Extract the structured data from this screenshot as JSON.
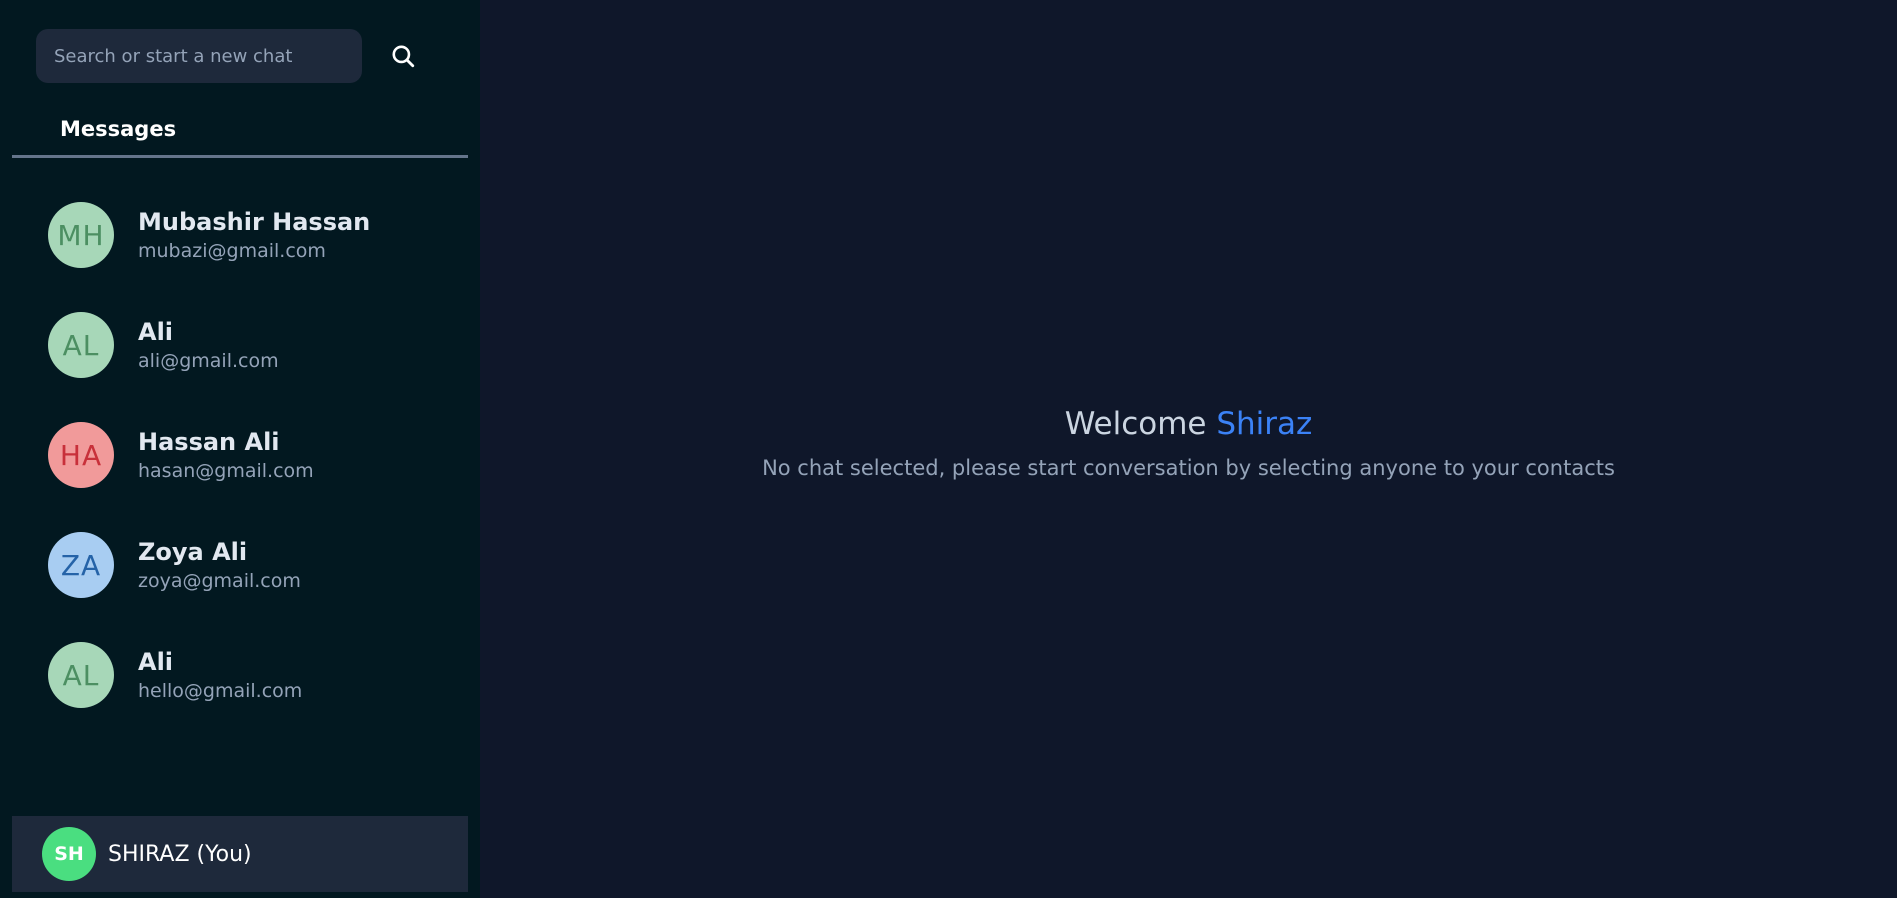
{
  "search": {
    "placeholder": "Search or start a new chat",
    "icon": "search-icon"
  },
  "tabs": {
    "messages_label": "Messages"
  },
  "contacts": [
    {
      "initials": "MH",
      "name": "Mubashir Hassan",
      "email": "mubazi@gmail.com",
      "avatar_bg": "#a7d7b8",
      "avatar_fg": "#4c8f62"
    },
    {
      "initials": "AL",
      "name": "Ali",
      "email": "ali@gmail.com",
      "avatar_bg": "#a7d7b8",
      "avatar_fg": "#4c8f62"
    },
    {
      "initials": "HA",
      "name": "Hassan Ali",
      "email": "hasan@gmail.com",
      "avatar_bg": "#f19a9a",
      "avatar_fg": "#c8303a"
    },
    {
      "initials": "ZA",
      "name": "Zoya Ali",
      "email": "zoya@gmail.com",
      "avatar_bg": "#a8cdf2",
      "avatar_fg": "#2563a8"
    },
    {
      "initials": "AL",
      "name": "Ali",
      "email": "hello@gmail.com",
      "avatar_bg": "#a7d7b8",
      "avatar_fg": "#4c8f62"
    }
  ],
  "current_user": {
    "initials": "SH",
    "label": "SHIRAZ (You)",
    "avatar_bg": "#4ade80"
  },
  "main": {
    "welcome_prefix": "Welcome ",
    "welcome_name": "Shiraz",
    "subtitle": "No chat selected, please start conversation by selecting anyone to your contacts"
  },
  "colors": {
    "sidebar_bg": "#021820",
    "main_bg": "#0f172a",
    "accent": "#3b82f6"
  }
}
